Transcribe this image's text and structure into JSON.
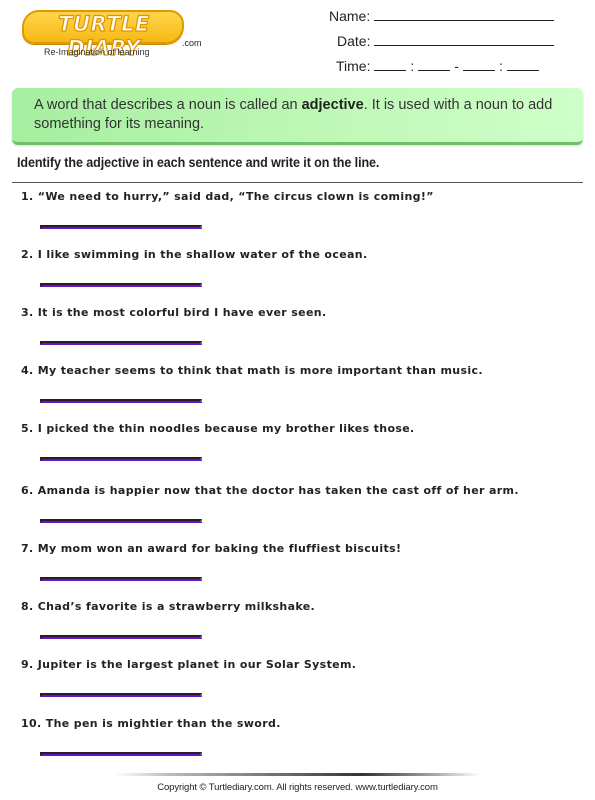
{
  "header": {
    "logo": {
      "brand": "TURTLE DIARY",
      "domain_suffix": ".com",
      "tagline": "Re-Imagination of learning",
      "colors": {
        "fill": "#f6b915",
        "outline": "#e09a00"
      }
    },
    "fields": {
      "name_label": "Name:",
      "date_label": "Date:",
      "time_label": "Time:",
      "time_separators": [
        ":",
        "-",
        ":"
      ]
    }
  },
  "intro": {
    "text_before": "A word that describes a noun is called an ",
    "term": "adjective",
    "text_after": ". It is used with a noun to add something for its meaning.",
    "background_color": "#b8f5b0"
  },
  "instruction": "Identify the adjective in each sentence and write it on the line.",
  "questions": [
    {
      "number": "1.",
      "text": "“We need to hurry,” said dad, “The circus clown is coming!”",
      "answer": ""
    },
    {
      "number": "2.",
      "text": "I like swimming in the shallow water of the ocean.",
      "answer": ""
    },
    {
      "number": "3.",
      "text": "It is the most colorful bird I have ever seen.",
      "answer": ""
    },
    {
      "number": "4.",
      "text": "My teacher seems to think that math is more important than music.",
      "answer": ""
    },
    {
      "number": "5.",
      "text": "I picked the thin noodles because my brother likes those.",
      "answer": ""
    },
    {
      "number": "6.",
      "text": "Amanda is happier now that the doctor has taken the cast off of her arm.",
      "answer": ""
    },
    {
      "number": "7.",
      "text": "My mom won an award for baking the fluffiest biscuits!",
      "answer": ""
    },
    {
      "number": "8.",
      "text": "Chad’s favorite is a strawberry milkshake.",
      "answer": ""
    },
    {
      "number": "9.",
      "text": "Jupiter is the largest planet in our Solar System.",
      "answer": ""
    },
    {
      "number": "10.",
      "text": "The pen is mightier than the sword.",
      "answer": ""
    }
  ],
  "answer_line_color": "#6a10c8",
  "footer": {
    "copyright": "Copyright © Turtlediary.com. All rights reserved. www.turtlediary.com"
  }
}
